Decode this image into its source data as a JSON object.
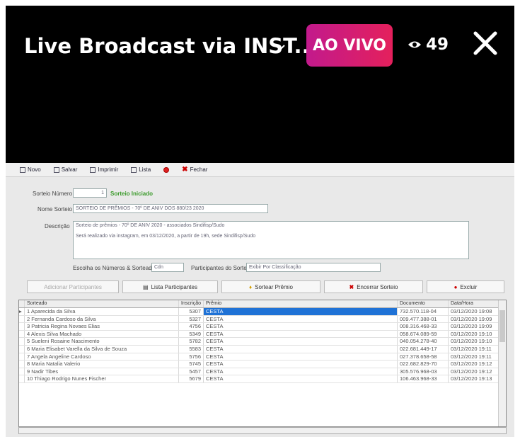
{
  "overlay": {
    "title": "Live Broadcast via INST...",
    "live_label": "AO VIVO",
    "viewer_count": "49",
    "icons": [
      "chevron-down-icon",
      "eye-icon",
      "close-icon"
    ]
  },
  "app": {
    "toolbar": {
      "novo": "Novo",
      "salvar": "Salvar",
      "imprimir": "Imprimir",
      "lista": "Lista",
      "fechar": "Fechar"
    },
    "form": {
      "sorteio_label": "Sorteio Número",
      "sorteio_value": "1",
      "sorteio_status": "Sorteio Iniciado",
      "nome_label": "Nome Sorteio",
      "nome_value": "SORTEIO DE PRÊMIOS - 70º DE ANIV DOS 880/23 2020",
      "descricao_label": "Descrição",
      "descricao_line1": "Sorteio de prêmios - 70º DE ANIV 2020 - associados Sindifisp/Sudo",
      "descricao_line2": "Será realizado via instagram, em 03/12/2020, a partir de 19h, sede Sindifisp/Sudo",
      "escolha_label": "Escolha os Números & Sorteados",
      "escolha_value": "Cdn",
      "participantes_label": "Participantes do Sorteio",
      "participantes_value": "Exibir Por Classificação"
    },
    "actions": {
      "add_participantes": "Adicionar Participantes",
      "lista_participantes": "Lista Participantes",
      "sortear_premio": "Sortear Prêmio",
      "encerrar_sorteio": "Encerrar Sorteio",
      "excluir": "Excluir"
    },
    "grid": {
      "headers": [
        "Sorteado",
        "Inscrição",
        "Prêmio",
        "Documento",
        "Data/Hora"
      ],
      "rows": [
        {
          "num": "1",
          "name": "Aparecida da Silva",
          "insc": "5307",
          "premio": "CESTA",
          "doc": "732.570.118-04",
          "data": "03/12/2020 19:08"
        },
        {
          "num": "2",
          "name": "Fernanda Cardoso da Silva",
          "insc": "5327",
          "premio": "CESTA",
          "doc": "009.477.388-01",
          "data": "03/12/2020 19:09"
        },
        {
          "num": "3",
          "name": "Patricia Regina Novaes Elias",
          "insc": "4756",
          "premio": "CESTA",
          "doc": "008.316.468-33",
          "data": "03/12/2020 19:09"
        },
        {
          "num": "4",
          "name": "Alexis Silva Machado",
          "insc": "5349",
          "premio": "CESTA",
          "doc": "058.674.089-59",
          "data": "03/12/2020 19:10"
        },
        {
          "num": "5",
          "name": "Sueleni Rosaine Nascimento",
          "insc": "5782",
          "premio": "CESTA",
          "doc": "040.054.278-40",
          "data": "03/12/2020 19:10"
        },
        {
          "num": "6",
          "name": "Maria Elisabet Varella da Silva de Souza",
          "insc": "5583",
          "premio": "CESTA",
          "doc": "022.681.449-17",
          "data": "03/12/2020 19:11"
        },
        {
          "num": "7",
          "name": "Angela Angeline Cardoso",
          "insc": "5756",
          "premio": "CESTA",
          "doc": "027.378.658-58",
          "data": "03/12/2020 19:11"
        },
        {
          "num": "8",
          "name": "Maria Natalia Valerio",
          "insc": "5745",
          "premio": "CESTA",
          "doc": "022.682.829-70",
          "data": "03/12/2020 19:12"
        },
        {
          "num": "9",
          "name": "Nadir Tibes",
          "insc": "5457",
          "premio": "CESTA",
          "doc": "305.576.968-03",
          "data": "03/12/2020 19:12"
        },
        {
          "num": "10",
          "name": "Thiago Rodrigo Nunes Fischer",
          "insc": "5679",
          "premio": "CESTA",
          "doc": "106.463.968-33",
          "data": "03/12/2020 19:13"
        }
      ]
    }
  },
  "colors": {
    "live_badge_start": "#c21a8c",
    "live_badge_end": "#e4205c",
    "selection": "#1f72d6",
    "status_green": "#3a9a2a"
  }
}
